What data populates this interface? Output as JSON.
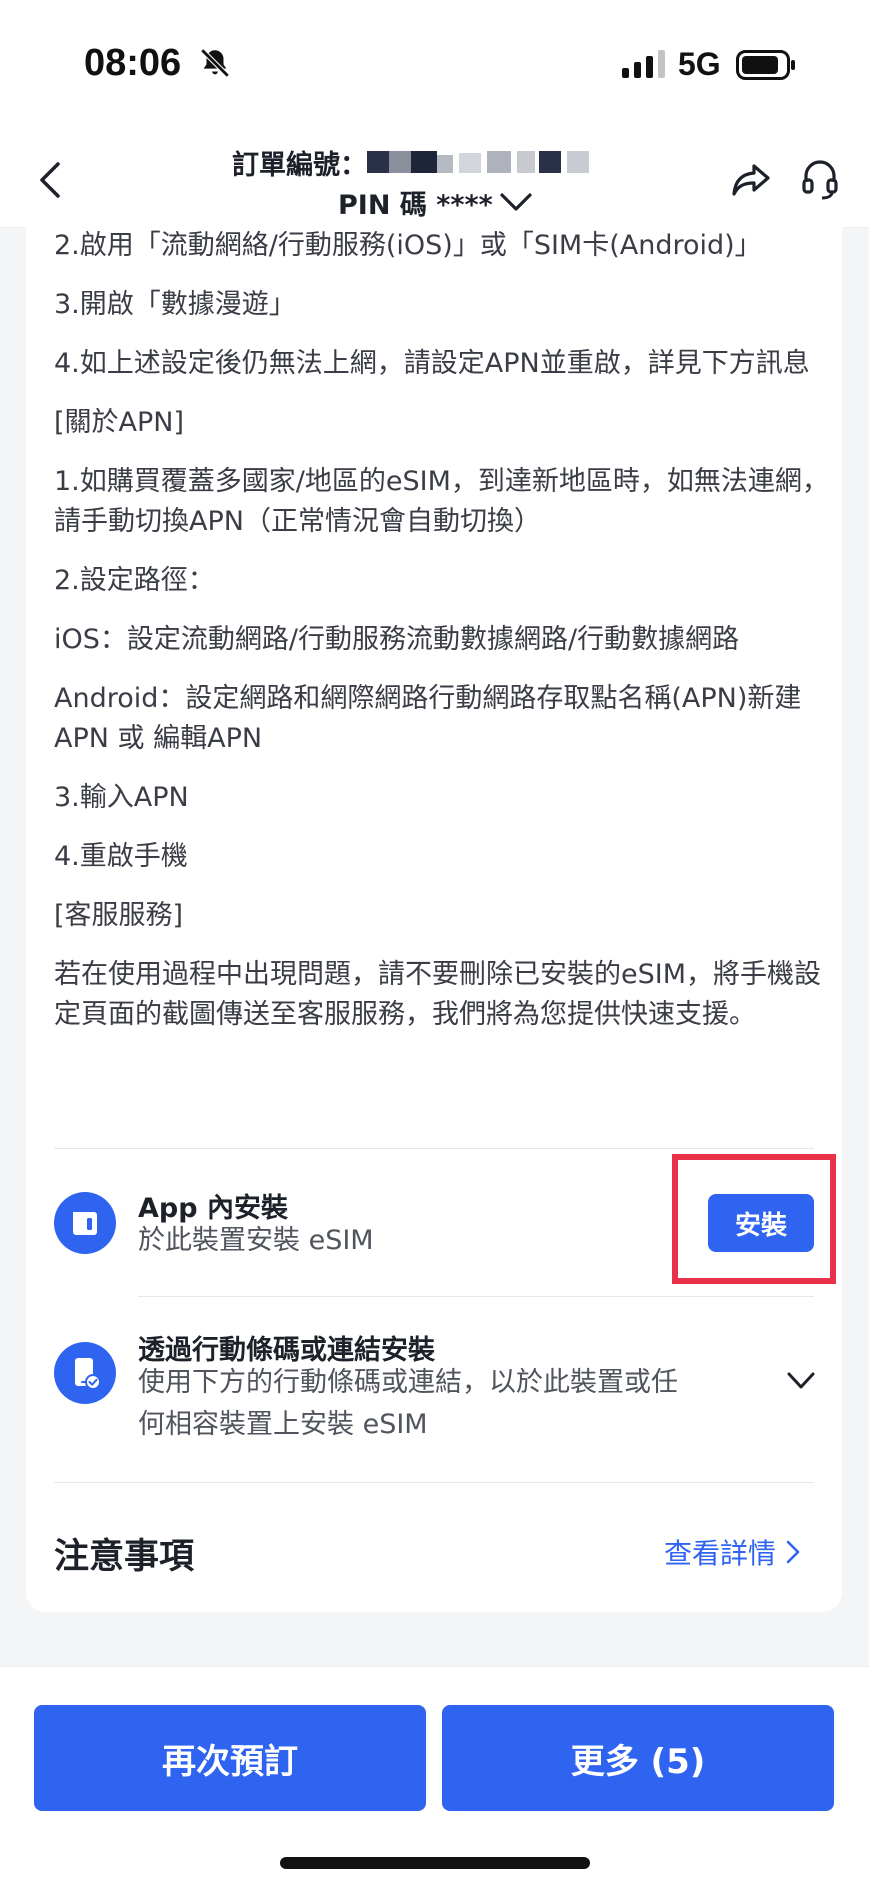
{
  "status_bar": {
    "time": "08:06",
    "network": "5G"
  },
  "header": {
    "order_label": "訂單編號：",
    "pin_label": "PIN 碼 ****"
  },
  "instructions": [
    "2.啟用「流動網絡/行動服務(iOS)」或「SIM卡(Android)」",
    "3.開啟「數據漫遊」",
    "4.如上述設定後仍無法上網，請設定APN並重啟，詳見下方訊息",
    "[關於APN]",
    "1.如購買覆蓋多國家/地區的eSIM，到達新地區時，如無法連網，請手動切換APN（正常情況會自動切換）",
    "2.設定路徑：",
    "iOS：設定流動網路/行動服務流動數據網路/行動數據網路",
    "Android：設定網路和網際網路行動網路存取點名稱(APN)新建APN 或 編輯APN",
    "3.輸入APN",
    "4.重啟手機",
    "[客服服務]",
    "若在使用過程中出現問題，請不要刪除已安裝的eSIM，將手機設定頁面的截圖傳送至客服服務，我們將為您提供快速支援。"
  ],
  "install_options": {
    "in_app": {
      "title": "App 內安裝",
      "subtitle": "於此裝置安裝 eSIM",
      "button": "安裝"
    },
    "qr": {
      "title": "透過行動條碼或連結安裝",
      "subtitle_line1": "使用下方的行動條碼或連結，以於此裝置或任",
      "subtitle_line2": "何相容裝置上安裝 eSIM"
    }
  },
  "notes": {
    "title": "注意事項",
    "link": "查看詳情"
  },
  "bottom_bar": {
    "rebook": "再次預訂",
    "more": "更多 (5)"
  },
  "colors": {
    "accent": "#2f64f0",
    "highlight": "#e8324a"
  }
}
